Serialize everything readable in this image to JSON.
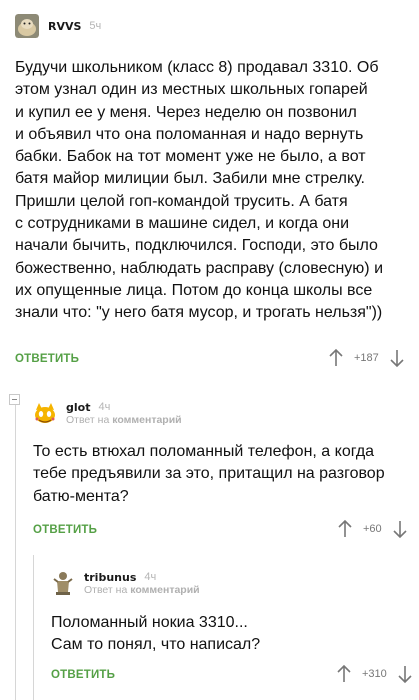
{
  "comments": [
    {
      "author": "RVVS",
      "time": "5ч",
      "paragraph_lines": [
        "Будучи школьником (класс 8) продавал 3310. Об",
        "этом узнал один из местных школьных гопарей",
        "и купил ее у меня. Через неделю он позвонил",
        "и объявил что она поломанная и надо вернуть",
        "бабки. Бабок на тот момент уже не было, а вот",
        "батя майор милиции был. Забили мне стрелку.",
        "Пришли целой гоп-командой трусить. А батя",
        "с сотрудниками в машине сидел, и когда они",
        "начали бычить, подключился. Господи, это было",
        "божественно, наблюдать расправу (словесную) и",
        "их опущенные лица. Потом до конца школы все",
        "знали что: \"у него батя мусор, и трогать нельзя\"))"
      ],
      "reply_label": "ОТВЕТИТЬ",
      "score": "+187"
    },
    {
      "author": "glot",
      "time": "4ч",
      "reply_to_prefix": "Ответ на",
      "reply_to_target": "комментарий",
      "paragraph_lines": [
        "То есть втюхал поломанный телефон, а когда",
        "тебе предъявили за это, притащил на разговор",
        "батю-мента?"
      ],
      "reply_label": "ОТВЕТИТЬ",
      "score": "+60"
    },
    {
      "author": "tribunus",
      "time": "4ч",
      "reply_to_prefix": "Ответ на",
      "reply_to_target": "комментарий",
      "paragraph_lines": [
        "Поломанный нокиа 3310...",
        "Сам то понял, что написал?"
      ],
      "reply_label": "ОТВЕТИТЬ",
      "score": "+310"
    }
  ],
  "colors": {
    "accent_green": "#55a046",
    "muted_text": "#b0b0b0",
    "thread_line": "#d6d6d6"
  },
  "icons": [
    "avatar-hamster",
    "avatar-cat-emoji",
    "avatar-statue",
    "arrow-up-icon",
    "arrow-down-icon",
    "collapse-icon"
  ]
}
